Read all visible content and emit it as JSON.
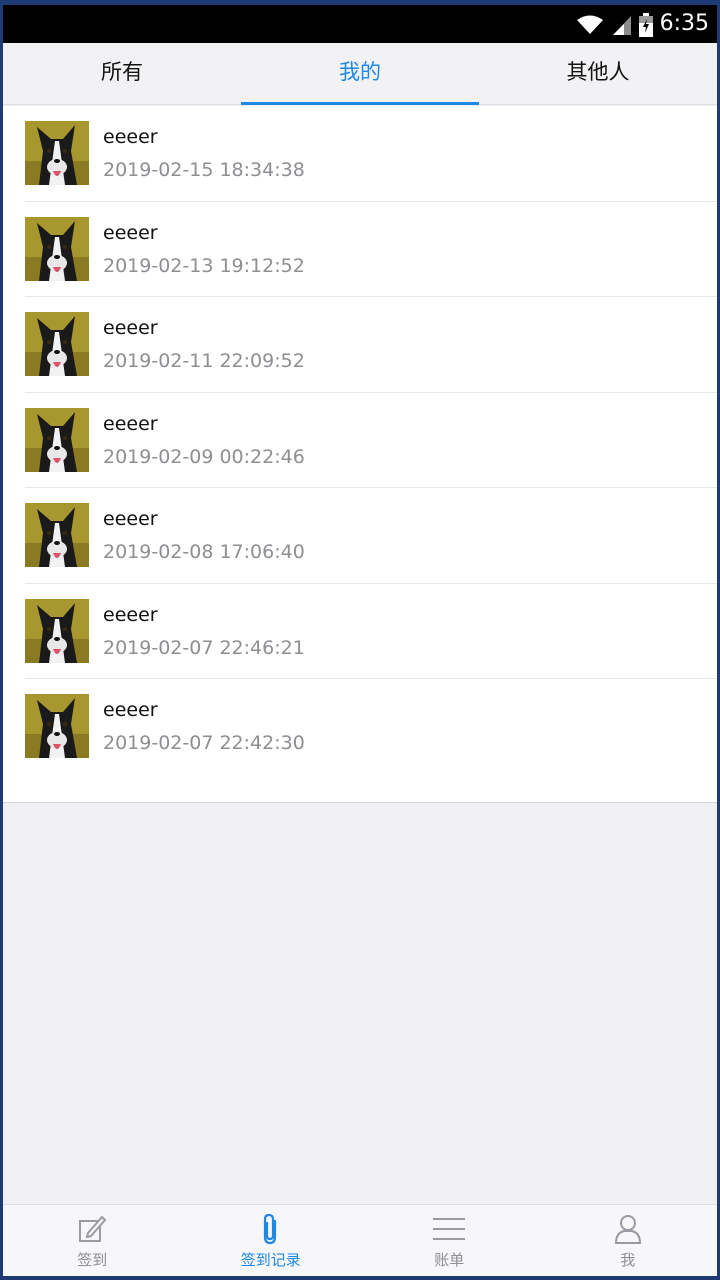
{
  "status_bar": {
    "time": "6:35"
  },
  "tabs": [
    {
      "label": "所有"
    },
    {
      "label": "我的"
    },
    {
      "label": "其他人"
    }
  ],
  "active_tab": 1,
  "records": [
    {
      "name": "eeeer",
      "time": "2019-02-15 18:34:38"
    },
    {
      "name": "eeeer",
      "time": "2019-02-13 19:12:52"
    },
    {
      "name": "eeeer",
      "time": "2019-02-11 22:09:52"
    },
    {
      "name": "eeeer",
      "time": "2019-02-09 00:22:46"
    },
    {
      "name": "eeeer",
      "time": "2019-02-08 17:06:40"
    },
    {
      "name": "eeeer",
      "time": "2019-02-07 22:46:21"
    },
    {
      "name": "eeeer",
      "time": "2019-02-07 22:42:30"
    }
  ],
  "bottom_nav": [
    {
      "label": "签到",
      "icon": "edit-icon"
    },
    {
      "label": "签到记录",
      "icon": "paperclip-icon"
    },
    {
      "label": "账单",
      "icon": "menu-icon"
    },
    {
      "label": "我",
      "icon": "person-icon"
    }
  ],
  "colors": {
    "accent": "#1e88e5",
    "secondary_text": "#8e8e93"
  }
}
